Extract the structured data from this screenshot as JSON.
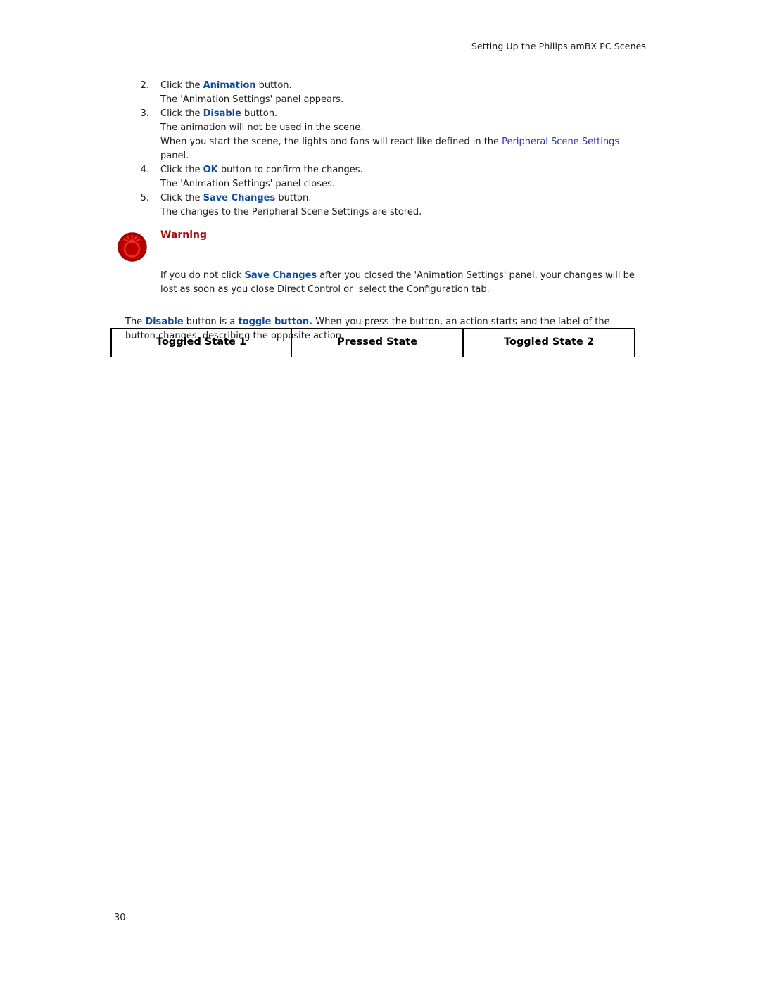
{
  "header": {
    "running_title": "Setting Up the Philips amBX PC Scenes"
  },
  "procedure": {
    "items": [
      {
        "number": "2.",
        "prefix": "Click the ",
        "term": "Animation",
        "suffix": " button.",
        "result": "The 'Animation Settings' panel appears."
      },
      {
        "number": "3.",
        "prefix": "Click the ",
        "term": "Disable",
        "suffix": " button.",
        "result": "The animation will not be used in the scene."
      },
      {
        "number": "4.",
        "prefix": "Click the ",
        "term": "OK",
        "suffix": " button to confirm the changes.",
        "result": "The 'Animation Settings' panel closes."
      },
      {
        "number": "5.",
        "prefix": "Click the ",
        "term": "Save Changes",
        "suffix": " button.",
        "result": "The changes to the Peripheral Scene Settings are stored."
      }
    ],
    "note_lead": "When you start the scene, the lights and fans will react like defined in the ",
    "note_link": "Peripheral Scene Settings",
    "note_tail": " panel."
  },
  "warning": {
    "icon_name": "bomb-warning-icon",
    "title": "Warning",
    "body_lead": "If you do not click ",
    "body_term": "Save Changes",
    "body_tail": " after you closed the 'Animation Settings' panel, your changes will be lost as soon as you close Direct Control or  select the Configuration tab.",
    "title_color": "#9d1111",
    "icon_outer_color": "#b80000",
    "icon_inner_color": "#e8222a"
  },
  "toggle_paragraph": {
    "lead": "The ",
    "term1": "Disable",
    "middle": " button is a ",
    "term2": "toggle button.",
    "tail": " When you press the button, an action starts and the label of the button changes, describing the opposite action."
  },
  "state_table": {
    "columns": [
      "Toggled State 1",
      "Pressed State",
      "Toggled State 2"
    ]
  },
  "footer": {
    "page_number": "30"
  },
  "colors": {
    "ui_term_blue": "#0b4c9e",
    "cross_reference_blue": "#2a34a8",
    "warning_red": "#9d1111",
    "body_text": "#1a1a1a"
  }
}
